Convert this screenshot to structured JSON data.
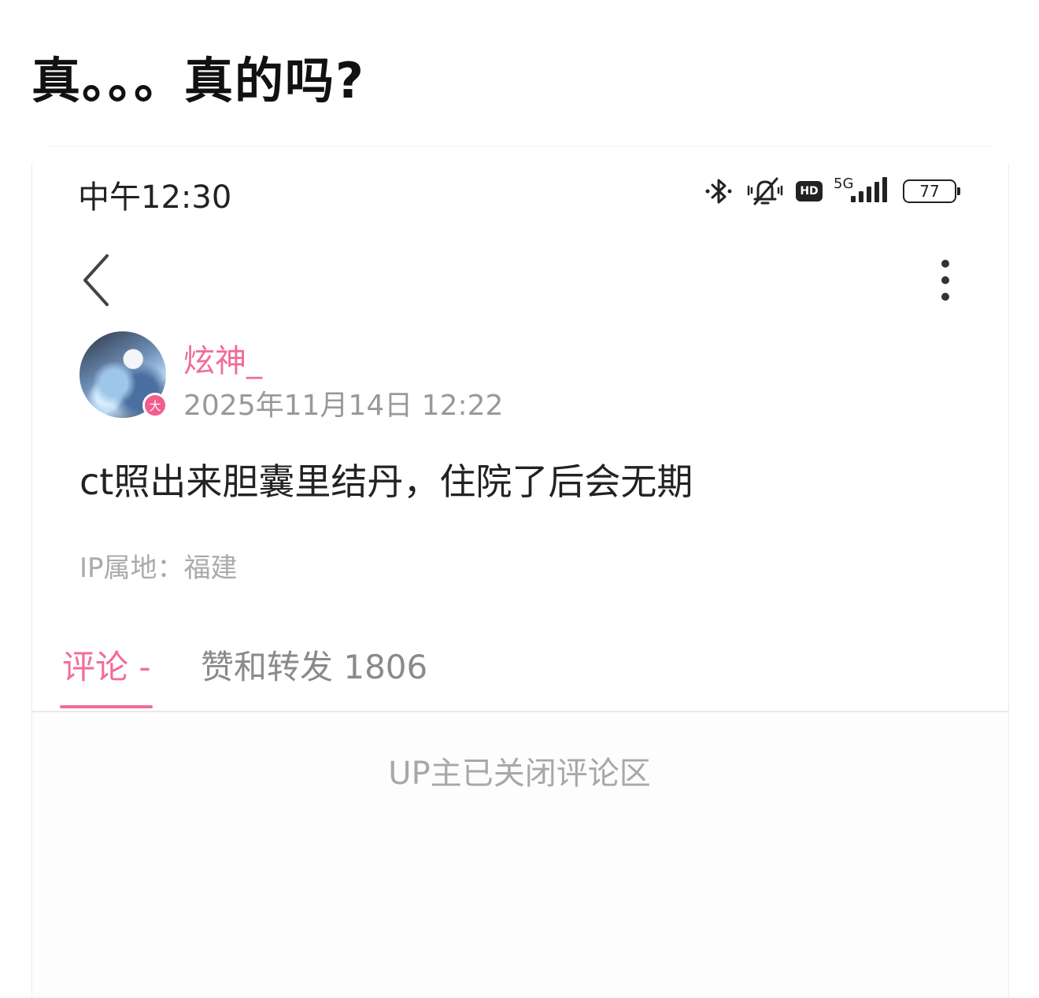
{
  "post_title": "真。。。真的吗?",
  "status_bar": {
    "time": "中午12:30",
    "network": "5G",
    "hd_label": "HD",
    "battery": "77",
    "icons": [
      "bluetooth-icon",
      "mute-icon",
      "hd-icon",
      "signal-icon",
      "battery-icon"
    ]
  },
  "nav": {
    "back_icon": "chevron-left-icon",
    "more_icon": "more-vertical-icon"
  },
  "author": {
    "name": "炫神_",
    "badge": "大",
    "post_time": "2025年11月14日 12:22"
  },
  "post": {
    "content": "ct照出来胆囊里结丹，住院了后会无期",
    "ip_location": "IP属地：福建"
  },
  "tabs": {
    "comments_label": "评论 -",
    "likes_label": "赞和转发 1806"
  },
  "comments": {
    "closed_message": "UP主已关闭评论区"
  },
  "colors": {
    "accent": "#f06d98",
    "text": "#222222",
    "muted": "#999999"
  }
}
